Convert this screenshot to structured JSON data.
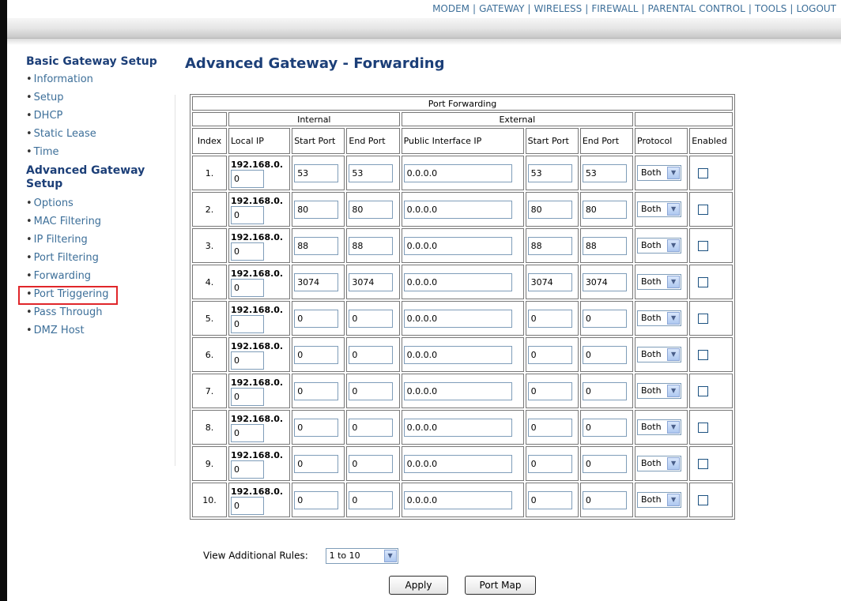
{
  "top_nav": [
    "MODEM",
    "GATEWAY",
    "WIRELESS",
    "FIREWALL",
    "PARENTAL CONTROL",
    "TOOLS",
    "LOGOUT"
  ],
  "sidebar": {
    "basic_title": "Basic Gateway Setup",
    "basic_items": [
      "Information",
      "Setup",
      "DHCP",
      "Static Lease",
      "Time"
    ],
    "advanced_title": "Advanced Gateway Setup",
    "advanced_items": [
      "Options",
      "MAC Filtering",
      "IP Filtering",
      "Port Filtering",
      "Forwarding",
      "Port Triggering",
      "Pass Through",
      "DMZ Host"
    ]
  },
  "page_title": "Advanced Gateway - Forwarding",
  "table": {
    "caption": "Port Forwarding",
    "group_internal": "Internal",
    "group_external": "External",
    "headers": {
      "index": "Index",
      "local_ip": "Local IP",
      "start_port": "Start Port",
      "end_port": "End Port",
      "public_ip": "Public Interface IP",
      "ext_start_port": "Start Port",
      "ext_end_port": "End Port",
      "protocol": "Protocol",
      "enabled": "Enabled"
    },
    "ip_prefix": "192.168.0.",
    "rows": [
      {
        "index": "1.",
        "local_ip": "0",
        "start": "53",
        "end": "53",
        "public": "0.0.0.0",
        "ext_start": "53",
        "ext_end": "53",
        "protocol": "Both",
        "enabled": false
      },
      {
        "index": "2.",
        "local_ip": "0",
        "start": "80",
        "end": "80",
        "public": "0.0.0.0",
        "ext_start": "80",
        "ext_end": "80",
        "protocol": "Both",
        "enabled": false
      },
      {
        "index": "3.",
        "local_ip": "0",
        "start": "88",
        "end": "88",
        "public": "0.0.0.0",
        "ext_start": "88",
        "ext_end": "88",
        "protocol": "Both",
        "enabled": false
      },
      {
        "index": "4.",
        "local_ip": "0",
        "start": "3074",
        "end": "3074",
        "public": "0.0.0.0",
        "ext_start": "3074",
        "ext_end": "3074",
        "protocol": "Both",
        "enabled": false
      },
      {
        "index": "5.",
        "local_ip": "0",
        "start": "0",
        "end": "0",
        "public": "0.0.0.0",
        "ext_start": "0",
        "ext_end": "0",
        "protocol": "Both",
        "enabled": false
      },
      {
        "index": "6.",
        "local_ip": "0",
        "start": "0",
        "end": "0",
        "public": "0.0.0.0",
        "ext_start": "0",
        "ext_end": "0",
        "protocol": "Both",
        "enabled": false
      },
      {
        "index": "7.",
        "local_ip": "0",
        "start": "0",
        "end": "0",
        "public": "0.0.0.0",
        "ext_start": "0",
        "ext_end": "0",
        "protocol": "Both",
        "enabled": false
      },
      {
        "index": "8.",
        "local_ip": "0",
        "start": "0",
        "end": "0",
        "public": "0.0.0.0",
        "ext_start": "0",
        "ext_end": "0",
        "protocol": "Both",
        "enabled": false
      },
      {
        "index": "9.",
        "local_ip": "0",
        "start": "0",
        "end": "0",
        "public": "0.0.0.0",
        "ext_start": "0",
        "ext_end": "0",
        "protocol": "Both",
        "enabled": false
      },
      {
        "index": "10.",
        "local_ip": "0",
        "start": "0",
        "end": "0",
        "public": "0.0.0.0",
        "ext_start": "0",
        "ext_end": "0",
        "protocol": "Both",
        "enabled": false
      }
    ]
  },
  "view_rules": {
    "label": "View Additional Rules:",
    "selected": "1 to 10"
  },
  "buttons": {
    "apply": "Apply",
    "port_map": "Port Map"
  },
  "colors": {
    "nav_link": "#3d6f99",
    "heading": "#1c3f78",
    "highlight": "#e0262a"
  }
}
